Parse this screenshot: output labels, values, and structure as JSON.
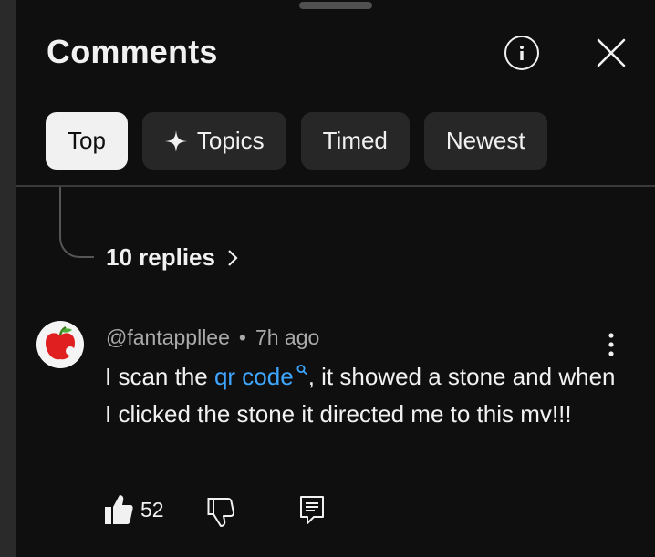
{
  "panel": {
    "title": "Comments",
    "info_icon": "info-icon",
    "close_icon": "close-icon"
  },
  "chips": [
    {
      "label": "Top",
      "active": true
    },
    {
      "label": "Topics",
      "icon": "sparkle-icon"
    },
    {
      "label": "Timed"
    },
    {
      "label": "Newest"
    }
  ],
  "thread": {
    "replies_label": "10 replies"
  },
  "comment": {
    "author": "@fantappllee",
    "separator": "•",
    "time": "7h ago",
    "text_before": "I scan the ",
    "link_text": "qr code",
    "text_after": ", it showed a stone and when I clicked the stone it directed me to this mv!!!",
    "likes": "52"
  },
  "colors": {
    "background": "#0f0f0f",
    "chip_bg": "#272727",
    "chip_active_bg": "#f1f1f1",
    "link": "#3ea6ff",
    "secondary_text": "#aaaaaa"
  }
}
